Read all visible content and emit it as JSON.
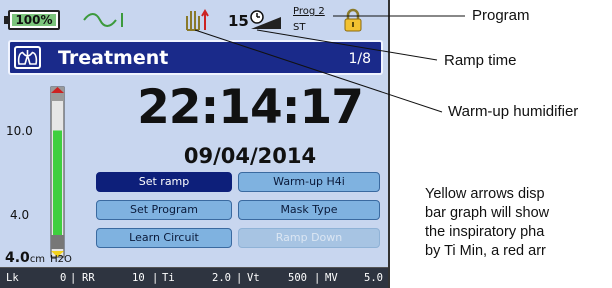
{
  "status_bar": {
    "battery_text": "100%",
    "ramp_time_value": "15",
    "program_label": "Prog 2",
    "st_label": "ST",
    "icons": [
      "battery-icon",
      "airflow-icon",
      "humidifier-warmup-icon",
      "ramp-icon",
      "lock-icon"
    ]
  },
  "header": {
    "title": "Treatment",
    "page_indicator": "1/8",
    "icon": "lungs-icon"
  },
  "pressure_bar": {
    "axis_top_label": "10.0",
    "axis_bottom_label": "4.0",
    "value": "4.0",
    "unit": "cm H2O",
    "unit_prefix": "cm",
    "unit_suffix": "H2O",
    "fill_fraction": 0.78
  },
  "clock": {
    "time": "22:14:17",
    "date": "09/04/2014"
  },
  "buttons": [
    {
      "label": "Set ramp",
      "state": "selected"
    },
    {
      "label": "Warm-up H4i",
      "state": "normal"
    },
    {
      "label": "Set Program",
      "state": "normal"
    },
    {
      "label": "Mask Type",
      "state": "normal"
    },
    {
      "label": "Learn Circuit",
      "state": "normal"
    },
    {
      "label": "Ramp Down",
      "state": "disabled"
    }
  ],
  "metrics": [
    {
      "label": "Lk",
      "value": "0"
    },
    {
      "label": "RR",
      "value": "10"
    },
    {
      "label": "Ti",
      "value": "2.0"
    },
    {
      "label": "Vt",
      "value": "500"
    },
    {
      "label": "MV",
      "value": "5.0"
    }
  ],
  "annotations": {
    "program": "Program",
    "ramp_time": "Ramp time",
    "warmup_humidifier": "Warm-up humidifier",
    "note_lines": [
      "Yellow arrows disp",
      "bar graph will show",
      "the inspiratory pha",
      "by Ti Min, a red arr"
    ]
  },
  "colors": {
    "screen_bg": "#c8d6ef",
    "title_bar": "#1a2a8a",
    "button": "#7fb2e0",
    "button_selected": "#0d1f7a",
    "button_disabled": "#a7c4e3",
    "pressure_fill": "#3fcf3f",
    "metrics_bar": "#2e3440"
  }
}
